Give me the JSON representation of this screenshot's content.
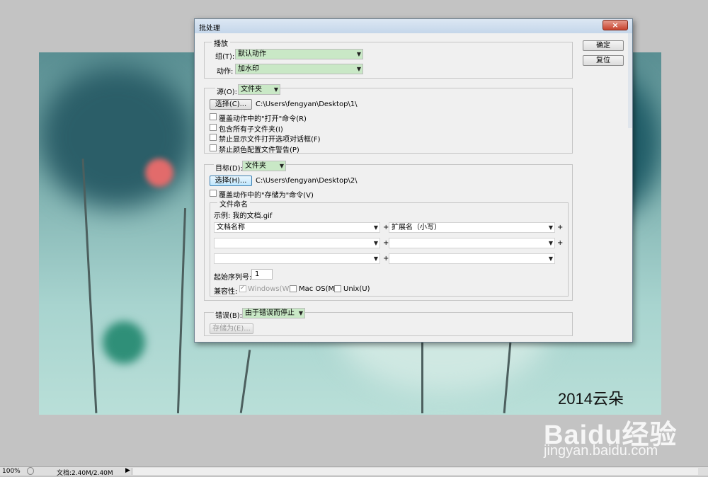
{
  "dialog": {
    "title": "批处理",
    "close_label": "×"
  },
  "buttons": {
    "ok": "确定",
    "reset": "复位"
  },
  "play": {
    "group_label": "播放",
    "set_label": "组(T):",
    "set_value": "默认动作",
    "action_label": "动作:",
    "action_value": "加水印"
  },
  "source": {
    "label": "源(O):",
    "value": "文件夹",
    "choose_button": "选择(C)...",
    "path": "C:\\Users\\fengyan\\Desktop\\1\\",
    "options": [
      {
        "label": "覆盖动作中的\"打开\"命令(R)",
        "checked": false
      },
      {
        "label": "包含所有子文件夹(I)",
        "checked": false
      },
      {
        "label": "禁止显示文件打开选项对话框(F)",
        "checked": false
      },
      {
        "label": "禁止颜色配置文件警告(P)",
        "checked": false
      }
    ]
  },
  "destination": {
    "label": "目标(D):",
    "value": "文件夹",
    "choose_button": "选择(H)...",
    "path": "C:\\Users\\fengyan\\Desktop\\2\\",
    "override_label": "覆盖动作中的\"存储为\"命令(V)",
    "naming": {
      "group_label": "文件命名",
      "example": "示例: 我的文档.gif",
      "rows": [
        {
          "left": "文档名称",
          "right": "扩展名（小写）"
        },
        {
          "left": "",
          "right": ""
        },
        {
          "left": "",
          "right": ""
        }
      ],
      "serial_label": "起始序列号:",
      "serial_value": "1",
      "compat_label": "兼容性:",
      "compat": [
        {
          "label": "Windows(W)",
          "checked": true,
          "disabled": true
        },
        {
          "label": "Mac OS(M)",
          "checked": false,
          "disabled": false
        },
        {
          "label": "Unix(U)",
          "checked": false,
          "disabled": false
        }
      ]
    }
  },
  "errors": {
    "label": "错误(B):",
    "value": "由于错误而停止",
    "save_as_button": "存储为(E)..."
  },
  "plus_sign": "+",
  "statusbar": {
    "zoom": "100%",
    "doc": "文档:2.40M/2.40M"
  },
  "watermark": {
    "year": "2014云朵",
    "logo": "Baidu经验",
    "url": "jingyan.baidu.com"
  },
  "colors": {
    "select_bg": "#c9e8c6",
    "close_btn": "#c7432e",
    "focus_btn": "#bee6fd"
  }
}
